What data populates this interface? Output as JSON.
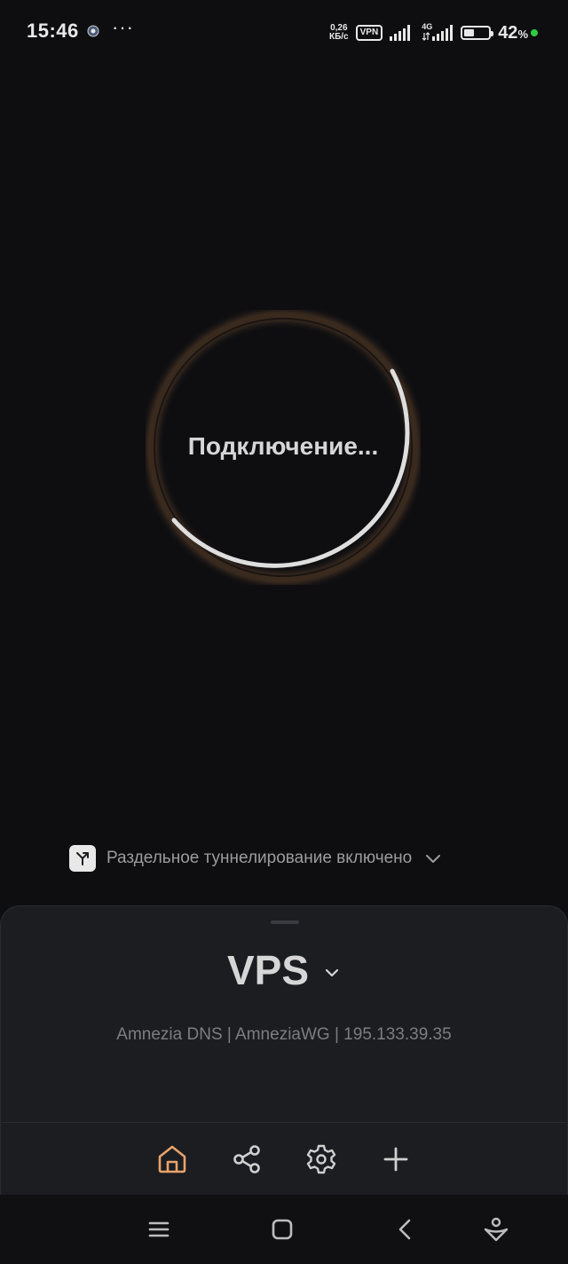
{
  "status_bar": {
    "time": "15:46",
    "dots": "···",
    "net_speed_value": "0,26",
    "net_speed_unit": "КБ/с",
    "vpn_badge": "VPN",
    "network_type": "4G",
    "battery_percent": "42",
    "battery_percent_sign": "%",
    "battery_level": 0.42
  },
  "connection": {
    "status_text": "Подключение..."
  },
  "split_tunneling": {
    "label": "Раздельное туннелирование включено",
    "icon": "split-arrow-icon"
  },
  "server": {
    "name": "VPS",
    "details": "Amnezia DNS | AmneziaWG | 195.133.39.35"
  },
  "tabs": [
    {
      "name": "home",
      "icon": "home-icon",
      "active": true
    },
    {
      "name": "share",
      "icon": "share-icon",
      "active": false
    },
    {
      "name": "settings",
      "icon": "gear-icon",
      "active": false
    },
    {
      "name": "add",
      "icon": "plus-icon",
      "active": false
    }
  ],
  "nav_bar": {
    "icons": [
      "menu-icon",
      "home-square-icon",
      "back-icon",
      "assistant-icon"
    ]
  },
  "colors": {
    "background": "#0e0e11",
    "sheet": "#1c1d21",
    "accent": "#e8a36c",
    "ring_glow": "#9c6a3f",
    "ring_progress": "#dedede",
    "text_primary": "#d6d6d6",
    "text_secondary": "#7d7d7d"
  }
}
